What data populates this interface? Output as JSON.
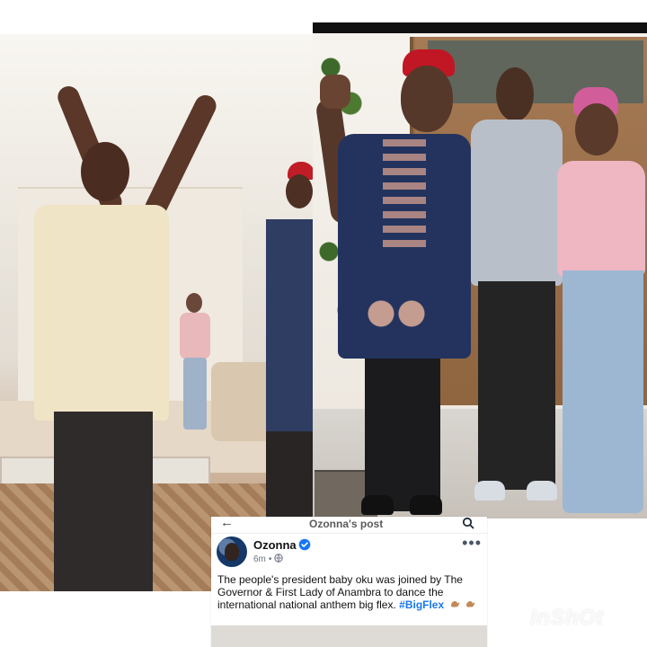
{
  "post": {
    "header_title": "Ozonna's post",
    "author_name": "Ozonna",
    "time_label": "6m",
    "body_text": "The people's president baby oku was joined by The Governor & First Lady of Anambra to dance the international national anthem big flex. ",
    "hashtag": "#BigFlex",
    "more_label": "•••"
  },
  "watermark": {
    "text": "InShOt"
  },
  "icons": {
    "back": "arrow-left-icon",
    "search": "search-icon",
    "verified": "verified-badge-icon",
    "globe": "globe-icon",
    "more": "more-options-icon",
    "emoji": "flexed-biceps-icon"
  },
  "colors": {
    "hashtag": "#1877f2",
    "verified": "#1877f2"
  }
}
